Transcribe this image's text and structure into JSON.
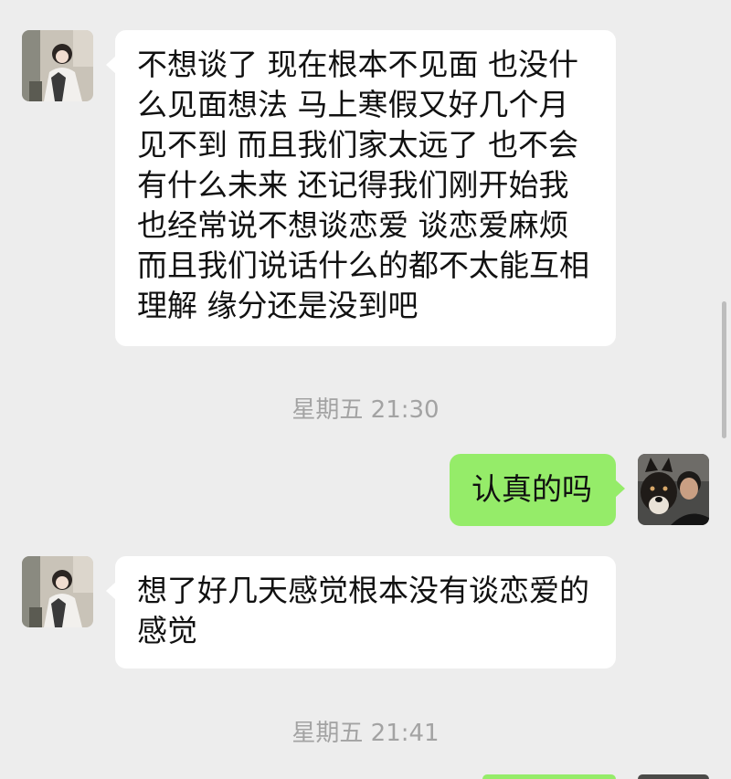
{
  "chat": {
    "msg1": {
      "lines": [
        "不想谈了 现在根本不见面 也没什",
        "么见面想法 马上寒假又好几个月",
        "见不到 而且我们家太远了 也不会",
        "有什么未来 还记得我们刚开始我",
        "也经常说不想谈恋爱 谈恋爱麻烦",
        "而且我们说话什么的都不太能互相",
        "理解 缘分还是没到吧"
      ]
    },
    "time1": "星期五 21:30",
    "msg2": {
      "text": "认真的吗"
    },
    "msg3": {
      "lines": [
        "想了好几天感觉根本没有谈恋爱的",
        "感觉"
      ]
    },
    "time2": "星期五 21:41"
  },
  "colors": {
    "background": "#ededed",
    "incoming_bubble": "#ffffff",
    "outgoing_bubble": "#95ec69",
    "timestamp": "#a3a3a3"
  },
  "icons": {
    "contact_avatar": "avatar-photo-girl",
    "self_avatar": "avatar-photo-man-with-dog"
  }
}
